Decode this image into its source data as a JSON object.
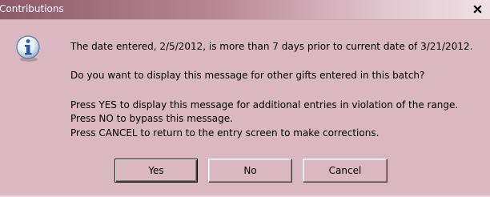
{
  "dialog": {
    "title": "Contributions",
    "close_label": "X",
    "icon": "info-icon",
    "message": {
      "line1": "The date entered, 2/5/2012, is more than 7 days prior to current date of 3/21/2012.",
      "line2": "Do you want to display this message for other gifts entered in this batch?",
      "line3": "Press YES to display this message for additional entries in violation of the range.",
      "line4": "Press NO to bypass this message.",
      "line5": "Press CANCEL to return to the entry screen to make corrections."
    },
    "buttons": {
      "yes_label": "Yes",
      "no_label": "No",
      "cancel_label": "Cancel"
    },
    "colors": {
      "dialog_background": "#d9b8c2",
      "titlebar_start": "#8e5a6a",
      "info_icon_fill": "#1f5db3"
    }
  }
}
